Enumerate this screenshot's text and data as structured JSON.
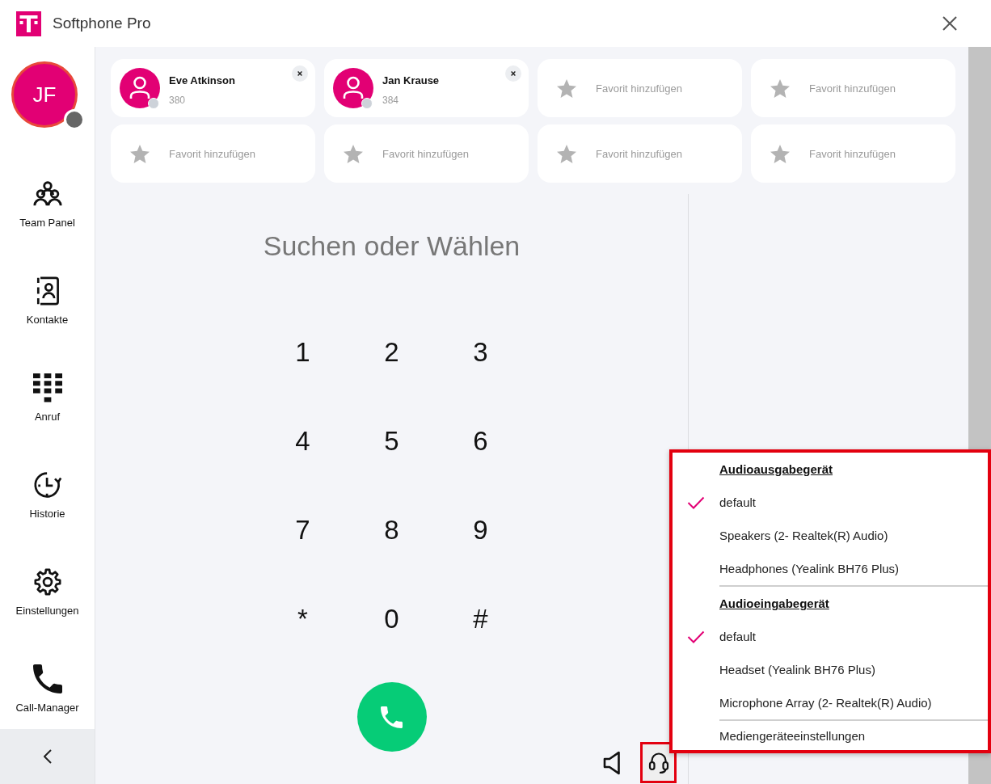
{
  "window": {
    "title": "Softphone Pro"
  },
  "user": {
    "initials": "JF"
  },
  "sidebar": {
    "items": [
      {
        "label": "Team Panel"
      },
      {
        "label": "Kontakte"
      },
      {
        "label": "Anruf"
      },
      {
        "label": "Historie"
      },
      {
        "label": "Einstellungen"
      },
      {
        "label": "Call-Manager"
      }
    ]
  },
  "favorites": [
    {
      "kind": "contact",
      "name": "Eve Atkinson",
      "number": "380"
    },
    {
      "kind": "contact",
      "name": "Jan Krause",
      "number": "384"
    },
    {
      "kind": "empty",
      "label": "Favorit hinzufügen"
    },
    {
      "kind": "empty",
      "label": "Favorit hinzufügen"
    },
    {
      "kind": "empty",
      "label": "Favorit hinzufügen"
    },
    {
      "kind": "empty",
      "label": "Favorit hinzufügen"
    },
    {
      "kind": "empty",
      "label": "Favorit hinzufügen"
    },
    {
      "kind": "empty",
      "label": "Favorit hinzufügen"
    }
  ],
  "dialer": {
    "placeholder": "Suchen oder Wählen",
    "keys": [
      "1",
      "2",
      "3",
      "4",
      "5",
      "6",
      "7",
      "8",
      "9",
      "*",
      "0",
      "#"
    ]
  },
  "audio_menu": {
    "open": true,
    "sections": [
      {
        "title": "Audioausgabegerät",
        "devices": [
          {
            "name": "default",
            "selected": true
          },
          {
            "name": "Speakers (2- Realtek(R) Audio)",
            "selected": false
          },
          {
            "name": "Headphones (Yealink BH76 Plus)",
            "selected": false
          }
        ]
      },
      {
        "title": "Audioeingabegerät",
        "devices": [
          {
            "name": "default",
            "selected": true
          },
          {
            "name": "Headset (Yealink BH76 Plus)",
            "selected": false
          },
          {
            "name": "Microphone Array (2- Realtek(R) Audio)",
            "selected": false
          }
        ]
      }
    ],
    "settings_label": "Mediengeräteeinstellungen"
  }
}
